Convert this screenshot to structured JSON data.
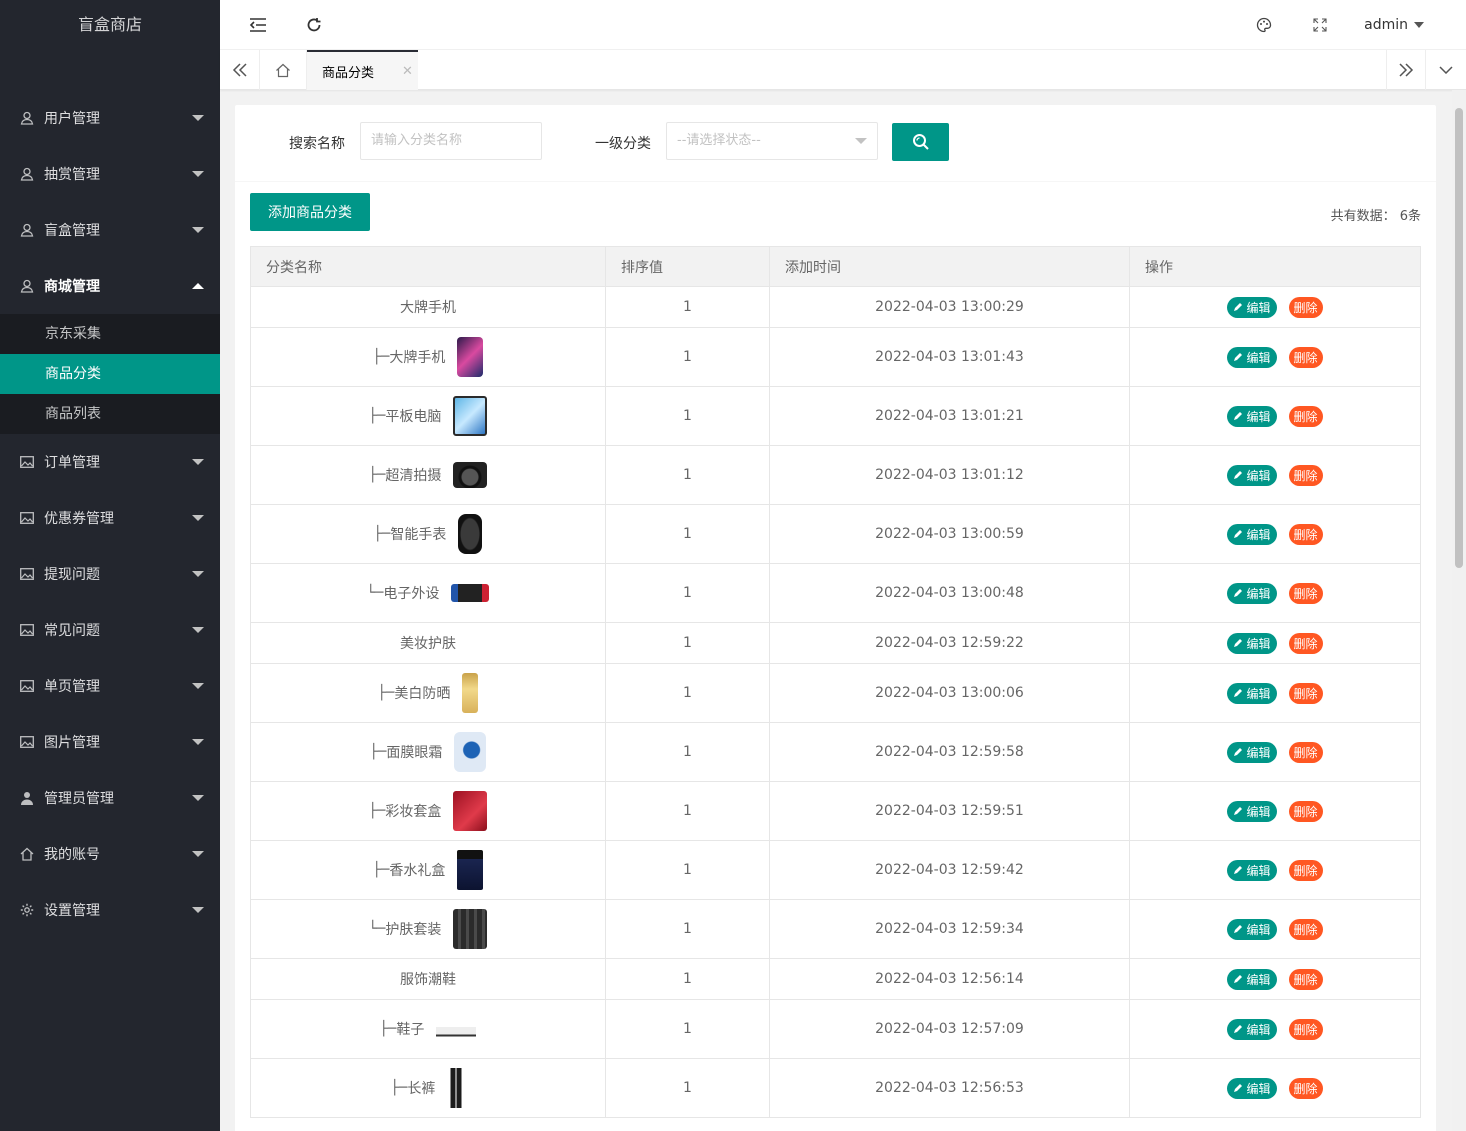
{
  "app": {
    "title": "盲盒商店"
  },
  "sidebar": {
    "items": [
      {
        "label": "用户管理",
        "icon": "user-icon"
      },
      {
        "label": "抽赏管理",
        "icon": "user-icon"
      },
      {
        "label": "盲盒管理",
        "icon": "user-icon"
      },
      {
        "label": "商城管理",
        "icon": "user-icon",
        "expanded": true,
        "children": [
          {
            "label": "京东采集"
          },
          {
            "label": "商品分类",
            "active": true
          },
          {
            "label": "商品列表"
          }
        ]
      },
      {
        "label": "订单管理",
        "icon": "image-icon"
      },
      {
        "label": "优惠券管理",
        "icon": "image-icon"
      },
      {
        "label": "提现问题",
        "icon": "image-icon"
      },
      {
        "label": "常见问题",
        "icon": "image-icon"
      },
      {
        "label": "单页管理",
        "icon": "image-icon"
      },
      {
        "label": "图片管理",
        "icon": "image-icon"
      },
      {
        "label": "管理员管理",
        "icon": "person-icon"
      },
      {
        "label": "我的账号",
        "icon": "home-icon"
      },
      {
        "label": "设置管理",
        "icon": "gear-icon"
      }
    ]
  },
  "header": {
    "user": "admin"
  },
  "tabs": {
    "active": "商品分类"
  },
  "search": {
    "name_label": "搜索名称",
    "name_placeholder": "请输入分类名称",
    "level_label": "一级分类",
    "level_placeholder": "--请选择状态--"
  },
  "toolbar": {
    "add_label": "添加商品分类",
    "total_label": "共有数据：",
    "total_value": "6条"
  },
  "table": {
    "headers": [
      "分类名称",
      "排序值",
      "添加时间",
      "操作"
    ],
    "edit_label": "编辑",
    "delete_label": "删除",
    "rows": [
      {
        "name": "大牌手机",
        "prefix": "",
        "sort": "1",
        "time": "2022-04-03 13:00:29",
        "thumb": ""
      },
      {
        "name": "大牌手机",
        "prefix": "├─",
        "sort": "1",
        "time": "2022-04-03 13:01:43",
        "thumb": "phone"
      },
      {
        "name": "平板电脑",
        "prefix": "├─",
        "sort": "1",
        "time": "2022-04-03 13:01:21",
        "thumb": "tablet"
      },
      {
        "name": "超清拍摄",
        "prefix": "├─",
        "sort": "1",
        "time": "2022-04-03 13:01:12",
        "thumb": "camera"
      },
      {
        "name": "智能手表",
        "prefix": "├─",
        "sort": "1",
        "time": "2022-04-03 13:00:59",
        "thumb": "watch"
      },
      {
        "name": "电子外设",
        "prefix": "└─",
        "sort": "1",
        "time": "2022-04-03 13:00:48",
        "thumb": "console"
      },
      {
        "name": "美妆护肤",
        "prefix": "",
        "sort": "1",
        "time": "2022-04-03 12:59:22",
        "thumb": ""
      },
      {
        "name": "美白防晒",
        "prefix": "├─",
        "sort": "1",
        "time": "2022-04-03 13:00:06",
        "thumb": "sunscreen"
      },
      {
        "name": "面膜眼霜",
        "prefix": "├─",
        "sort": "1",
        "time": "2022-04-03 12:59:58",
        "thumb": "mask"
      },
      {
        "name": "彩妆套盒",
        "prefix": "├─",
        "sort": "1",
        "time": "2022-04-03 12:59:51",
        "thumb": "giftbox"
      },
      {
        "name": "香水礼盒",
        "prefix": "├─",
        "sort": "1",
        "time": "2022-04-03 12:59:42",
        "thumb": "perfume"
      },
      {
        "name": "护肤套装",
        "prefix": "└─",
        "sort": "1",
        "time": "2022-04-03 12:59:34",
        "thumb": "skincare"
      },
      {
        "name": "服饰潮鞋",
        "prefix": "",
        "sort": "1",
        "time": "2022-04-03 12:56:14",
        "thumb": ""
      },
      {
        "name": "鞋子",
        "prefix": "├─",
        "sort": "1",
        "time": "2022-04-03 12:57:09",
        "thumb": "shoe"
      },
      {
        "name": "长裤",
        "prefix": "├─",
        "sort": "1",
        "time": "2022-04-03 12:56:53",
        "thumb": "pants"
      }
    ]
  },
  "colors": {
    "primary": "#009688",
    "danger": "#ff5722",
    "sidebar": "#23262e"
  }
}
